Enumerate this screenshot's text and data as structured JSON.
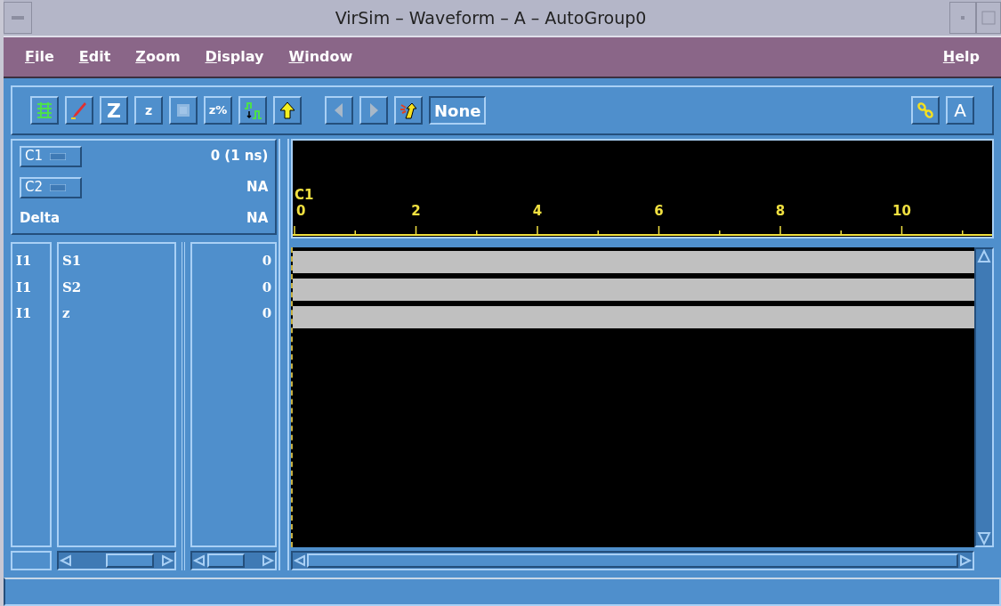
{
  "window": {
    "title": "VirSim – Waveform – A – AutoGroup0"
  },
  "menu": {
    "left": [
      "File",
      "Edit",
      "Zoom",
      "Display",
      "Window"
    ],
    "right": "Help"
  },
  "toolbar": {
    "z_large": "Z",
    "z_small": "z",
    "z_percent": "z%",
    "search_value": "None",
    "a_button": "A"
  },
  "cursors": [
    {
      "label": "C1",
      "value": "0 (1 ns)"
    },
    {
      "label": "C2",
      "value": "NA"
    }
  ],
  "delta": {
    "label": "Delta",
    "value": "NA"
  },
  "signals": [
    {
      "group": "I1",
      "name": "S1",
      "value": "0"
    },
    {
      "group": "I1",
      "name": "S2",
      "value": "0"
    },
    {
      "group": "I1",
      "name": "z",
      "value": "0"
    }
  ],
  "ruler": {
    "cursor": "C1",
    "labels": [
      "0",
      "2",
      "4",
      "6",
      "8",
      "10"
    ]
  }
}
